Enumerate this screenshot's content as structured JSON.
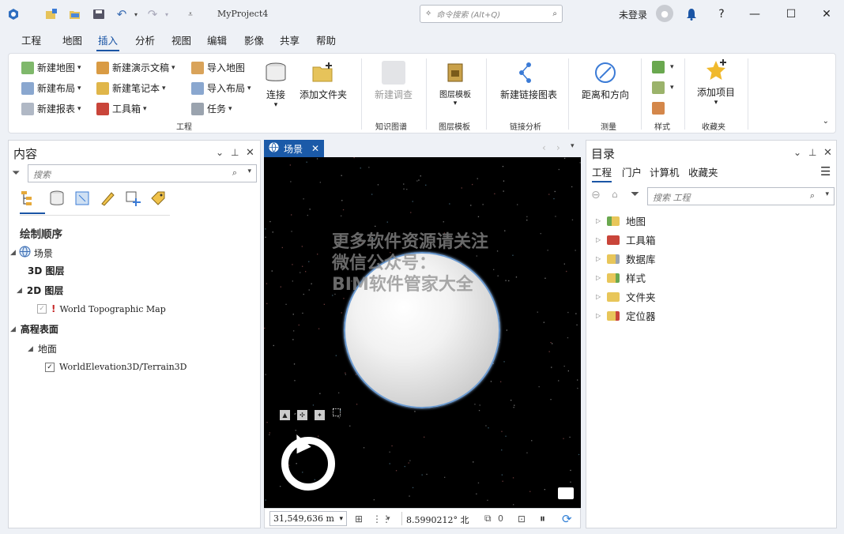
{
  "titlebar": {
    "title": "MyProject4",
    "search_placeholder": "命令搜索 (Alt+Q)",
    "login": "未登录",
    "minimize": "—",
    "maximize": "☐",
    "close": "✕",
    "help": "?"
  },
  "menu": [
    "工程",
    "地图",
    "插入",
    "分析",
    "视图",
    "编辑",
    "影像",
    "共享",
    "帮助"
  ],
  "ribbon": {
    "project_group": {
      "new_map": "新建地图",
      "new_layout": "新建布局",
      "new_report": "新建报表",
      "new_presentation": "新建演示文稿",
      "new_notebook": "新建笔记本",
      "toolbox": "工具箱",
      "import_map": "导入地图",
      "import_layout": "导入布局",
      "task": "任务",
      "connect": "连接",
      "add_folder": "添加文件夹",
      "label": "工程"
    },
    "knowledge_group": {
      "new_investigation": "新建调查",
      "label": "知识图谱"
    },
    "layer_template_group": {
      "layer_template": "图层模板",
      "label": "图层模板"
    },
    "link_group": {
      "new_link_chart": "新建链接图表",
      "label": "链接分析"
    },
    "measure_group": {
      "distance_direction": "距离和方向",
      "label": "测量"
    },
    "style_group": {
      "label": "样式"
    },
    "favorites_group": {
      "add_item": "添加项目",
      "label": "收藏夹"
    }
  },
  "contents": {
    "title": "内容",
    "search_placeholder": "搜索",
    "draw_order": "绘制顺序",
    "tree": {
      "scene": "场景",
      "layers_3d": "3D 图层",
      "layers_2d": "2D 图层",
      "topo_map": "World Topographic Map",
      "elevation_surfaces": "高程表面",
      "ground": "地面",
      "terrain": "WorldElevation3D/Terrain3D"
    }
  },
  "scene_view": {
    "tab_label": "场景",
    "watermark_lines": [
      "更多软件资源请关注",
      "微信公众号：",
      "BIM软件管家大全"
    ],
    "scale": "31,549,636 m",
    "coordinate": "8.5990212° 北",
    "selected_count": "0"
  },
  "catalog": {
    "title": "目录",
    "tabs": [
      "工程",
      "门户",
      "计算机",
      "收藏夹"
    ],
    "search_placeholder": "搜索 工程",
    "items": [
      "地图",
      "工具箱",
      "数据库",
      "样式",
      "文件夹",
      "定位器"
    ]
  },
  "colors": {
    "accent": "#1b5aa8",
    "scene_background": "#000000",
    "globe_outline": "#6c9bd1"
  }
}
